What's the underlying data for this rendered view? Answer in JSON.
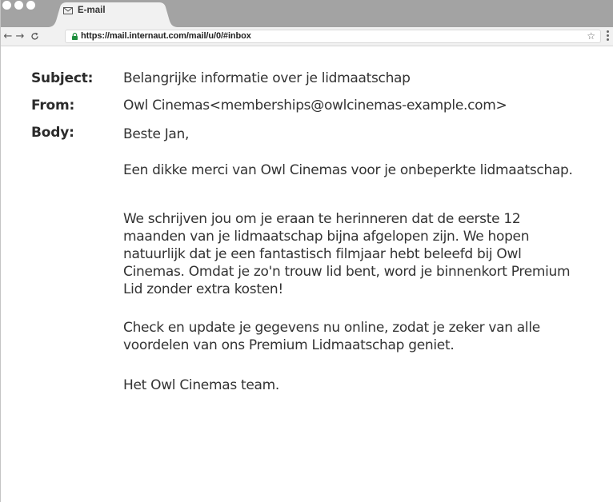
{
  "browser": {
    "tab_title": "E-mail",
    "url": "https://mail.internaut.com/mail/u/0/#inbox",
    "back_icon": "arrow-left-icon",
    "forward_icon": "arrow-right-icon",
    "reload_icon": "reload-icon",
    "star_icon": "star-icon",
    "tabstrip_color": "#a3a3a3",
    "toolbar_color": "#f1f1f1",
    "lock_color": "#1e8e3e"
  },
  "email": {
    "subject_label": "Subject:",
    "subject": "Belangrijke  informatie over je lidmaatschap",
    "from_label": "From:",
    "from": "Owl Cinemas<memberships@owlcinemas-example.com>",
    "body_label": "Body:",
    "body": [
      "Beste Jan,",
      "Een dikke merci van Owl Cinemas voor je onbeperkte lidmaatschap.",
      "We schrijven jou om je eraan te herinneren dat de eerste 12 maanden van je lidmaatschap bijna afgelopen zijn. We hopen natuurlijk dat je een fantastisch filmjaar hebt beleefd bij Owl Cinemas. Omdat je zo'n trouw lid bent, word je binnenkort Premium Lid zonder extra kosten!",
      "Check en update je gegevens nu online, zodat je zeker van alle voordelen van ons Premium Lidmaatschap geniet.",
      "Het Owl Cinemas team."
    ]
  }
}
